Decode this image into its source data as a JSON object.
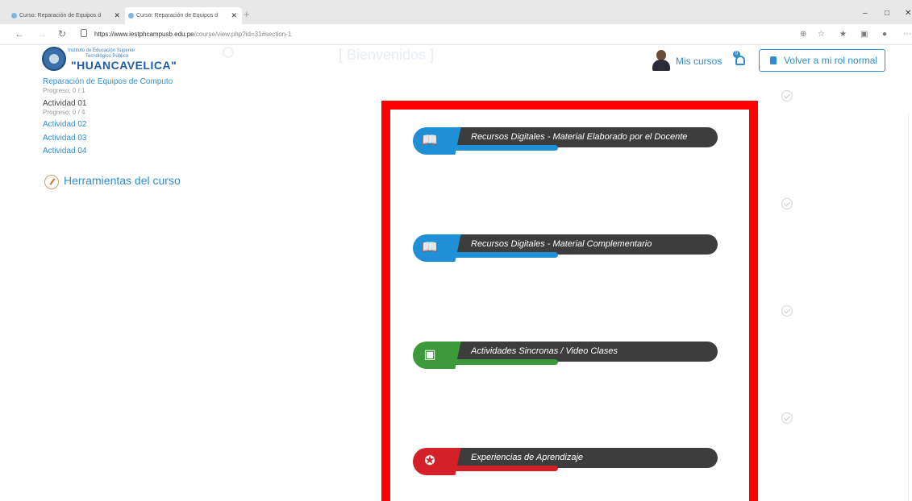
{
  "browser": {
    "tabs": [
      {
        "title": "Curso: Reparación de Equipos d"
      },
      {
        "title": "Curso: Reparación de Equipos d"
      }
    ],
    "tab_close": "✕",
    "new_tab": "+",
    "url_main": "https://www.iestphcampusb.edu.pe",
    "url_rest": "/course/view.php?id=31#section-1",
    "window_controls": {
      "minimize": "–",
      "maximize": "□",
      "close": "✕"
    }
  },
  "header": {
    "logo": {
      "line1": "Instituto de Educación Superior",
      "line2": "Tecnológico Público",
      "line3": "\"HUANCAVELICA\""
    },
    "faded_text": "[ Bienvenidos ]",
    "mis_cursos": "Mis cursos",
    "notification_count": "0",
    "volver_button": "Volver a mi rol normal"
  },
  "sidebar": {
    "course_title": "Reparación de Equipos de Computo",
    "course_progress": "Progreso: 0 / 1",
    "current_activity": "Actividad 01",
    "current_progress": "Progreso: 0 / 4",
    "links": [
      "Actividad 02",
      "Actividad 03",
      "Actividad 04"
    ],
    "tools": "Herramientas del curso"
  },
  "sections": [
    {
      "label": "Recursos Digitales - Material Elaborado por el Docente",
      "color": "#1f8fd6",
      "icon": "book-reader-icon"
    },
    {
      "label": "Recursos Digitales - Material Complementario",
      "color": "#1f8fd6",
      "icon": "book-reader-icon"
    },
    {
      "label": "Actividades Sincronas / Video Clases",
      "color": "#3d9a3a",
      "icon": "video-screen-icon"
    },
    {
      "label": "Experiencias de Aprendizaje",
      "color": "#d42028",
      "icon": "award-icon"
    }
  ],
  "colors": {
    "accent": "#2f8ed0",
    "highlight": "#ff0000",
    "banner_dark": "#3d3d3d"
  }
}
